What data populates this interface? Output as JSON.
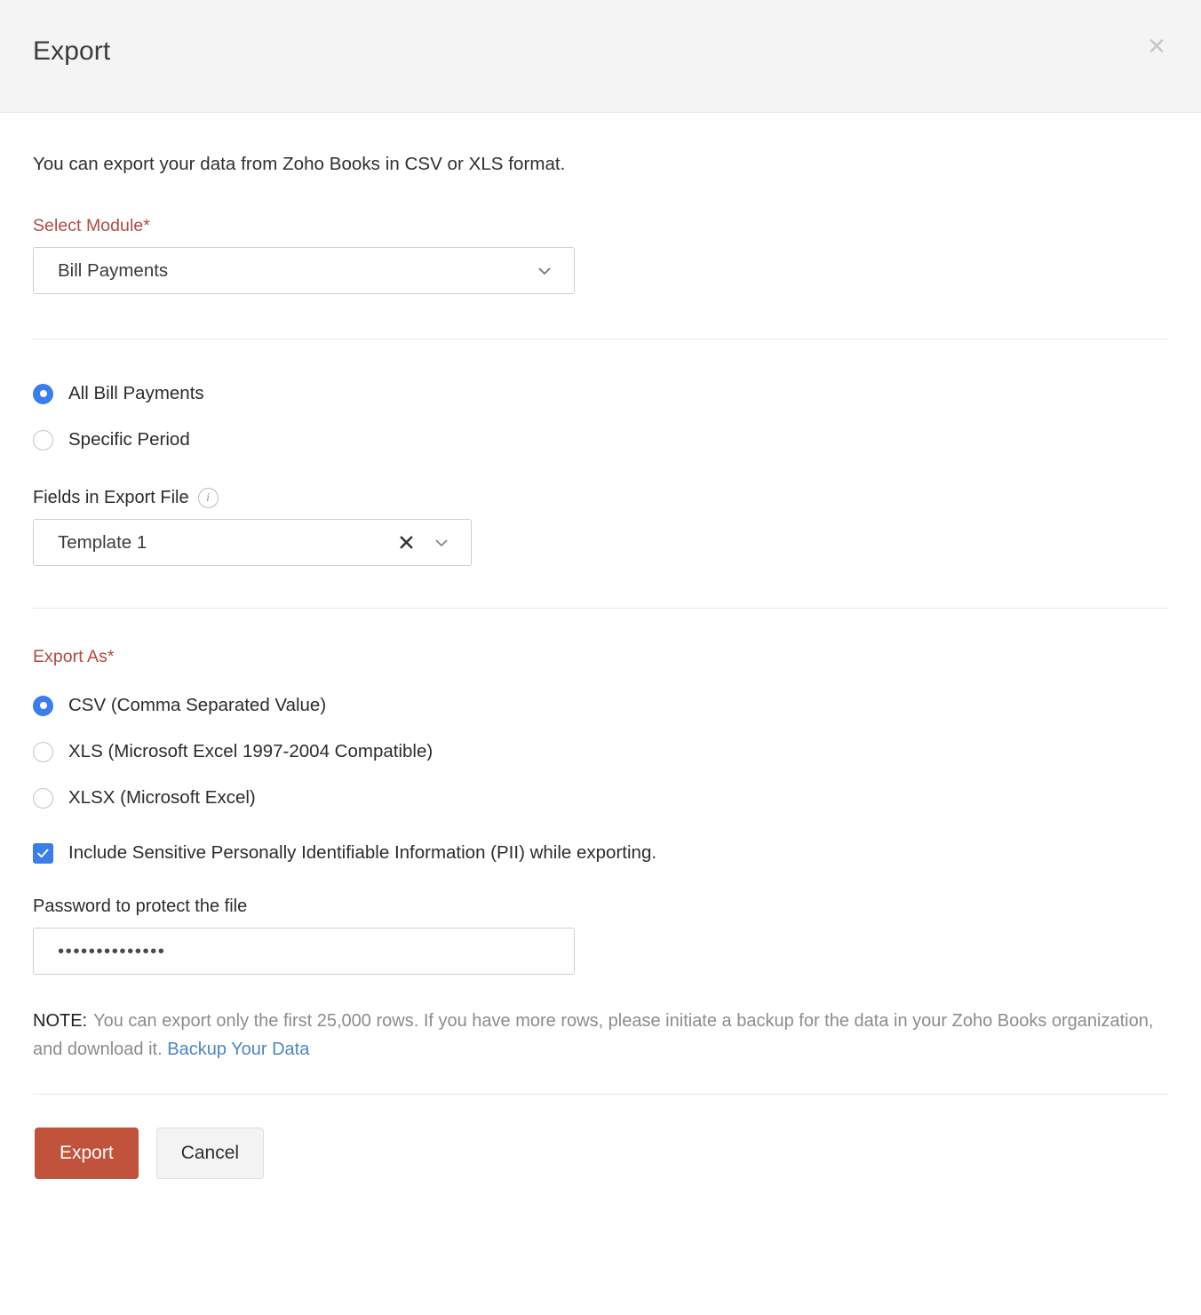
{
  "dialog": {
    "title": "Export",
    "close_icon": "close-icon",
    "intro": "You can export your data from Zoho Books in CSV or XLS format."
  },
  "module_section": {
    "label": "Select Module*",
    "selected": "Bill Payments",
    "chevron_icon": "chevron-down-icon"
  },
  "scope_section": {
    "options": [
      {
        "label": "All Bill Payments",
        "selected": true
      },
      {
        "label": "Specific Period",
        "selected": false
      }
    ]
  },
  "fields_section": {
    "label": "Fields in Export File",
    "info_icon": "info-icon",
    "selected": "Template 1",
    "clear_icon": "clear-x-icon",
    "chevron_icon": "chevron-down-icon"
  },
  "export_as": {
    "label": "Export As*",
    "options": [
      {
        "label": "CSV (Comma Separated Value)",
        "selected": true
      },
      {
        "label": "XLS (Microsoft Excel 1997-2004 Compatible)",
        "selected": false
      },
      {
        "label": "XLSX (Microsoft Excel)",
        "selected": false
      }
    ]
  },
  "pii": {
    "label": "Include Sensitive Personally Identifiable Information (PII) while exporting.",
    "checked": true,
    "check_icon": "checkmark-icon"
  },
  "password": {
    "label": "Password to protect the file",
    "value": "••••••••••••••",
    "placeholder": ""
  },
  "note": {
    "prefix": "NOTE:",
    "text": "You can export only the first 25,000 rows. If you have more rows, please initiate a backup for the data in your Zoho Books organization, and download it. ",
    "link_text": "Backup Your Data"
  },
  "footer": {
    "primary_label": "Export",
    "secondary_label": "Cancel"
  },
  "colors": {
    "accent_red": "#c1523c",
    "required_label": "#b5493f",
    "control_blue": "#3b7dec",
    "link_blue": "#4c86c4",
    "header_bg": "#f4f4f4"
  }
}
